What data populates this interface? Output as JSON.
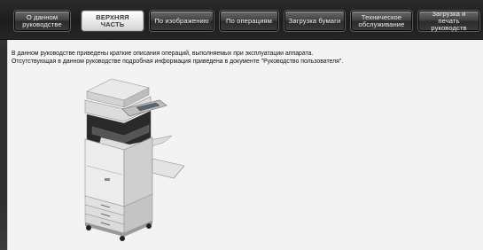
{
  "nav": {
    "tabs": [
      {
        "label": "О данном\nруководстве",
        "active": false
      },
      {
        "label": "ВЕРХНЯЯ ЧАСТЬ",
        "active": true
      },
      {
        "label": "По изображению",
        "active": false
      },
      {
        "label": "По операциям",
        "active": false
      },
      {
        "label": "Загрузка бумаги",
        "active": false
      },
      {
        "label": "Техническое\nобслуживание",
        "active": false
      },
      {
        "label": "Загрузка и печать\nруководств",
        "active": false
      }
    ]
  },
  "main": {
    "intro_line1": "В данном руководстве приведены краткие описания операций, выполняемых при эксплуатации аппарата.",
    "intro_line2": "Отсутствующая в данном руководстве подробная информация приведена в документе \"Руководство пользователя\"."
  },
  "image": {
    "subject": "copier-illustration"
  },
  "colors": {
    "active_tab_bg": "#ffffff",
    "tab_bg": "#3e3e3e",
    "content_bg": "#f3f3f3",
    "frame_bg": "#2f2f2f"
  }
}
